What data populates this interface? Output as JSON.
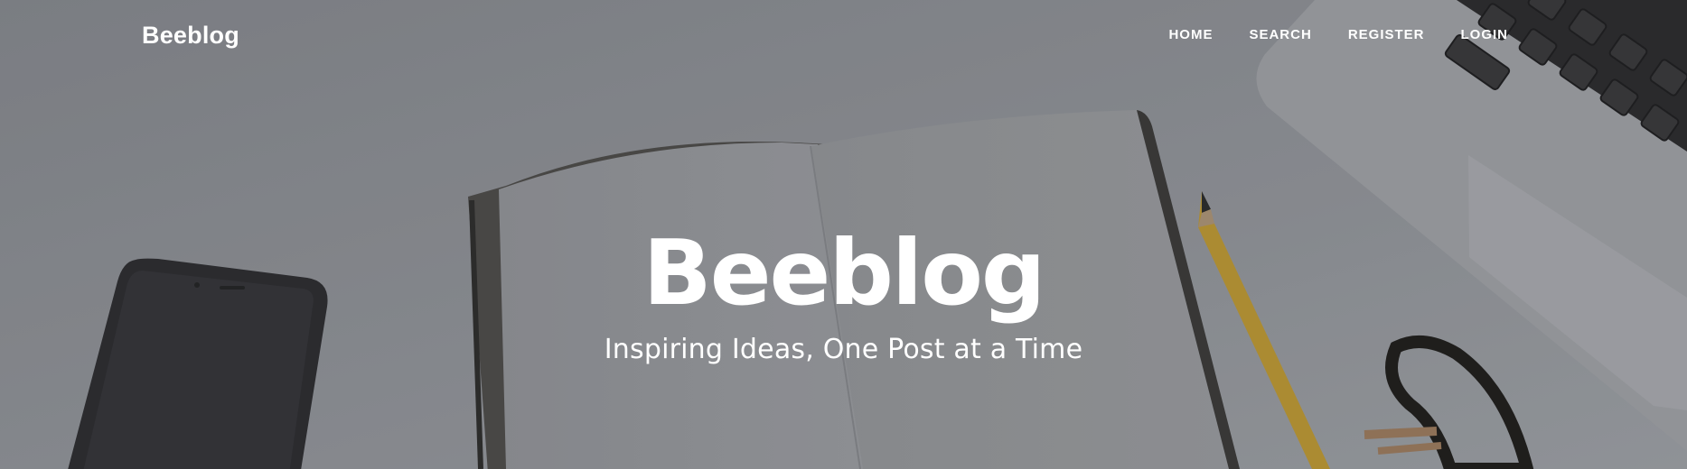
{
  "navbar": {
    "brand": "Beeblog",
    "items": [
      {
        "label": "HOME"
      },
      {
        "label": "SEARCH"
      },
      {
        "label": "REGISTER"
      },
      {
        "label": "LOGIN"
      }
    ]
  },
  "hero": {
    "title": "Beeblog",
    "subtitle": "Inspiring Ideas, One Post at a Time"
  },
  "colors": {
    "text": "#ffffff",
    "overlay": "#7f8186"
  }
}
